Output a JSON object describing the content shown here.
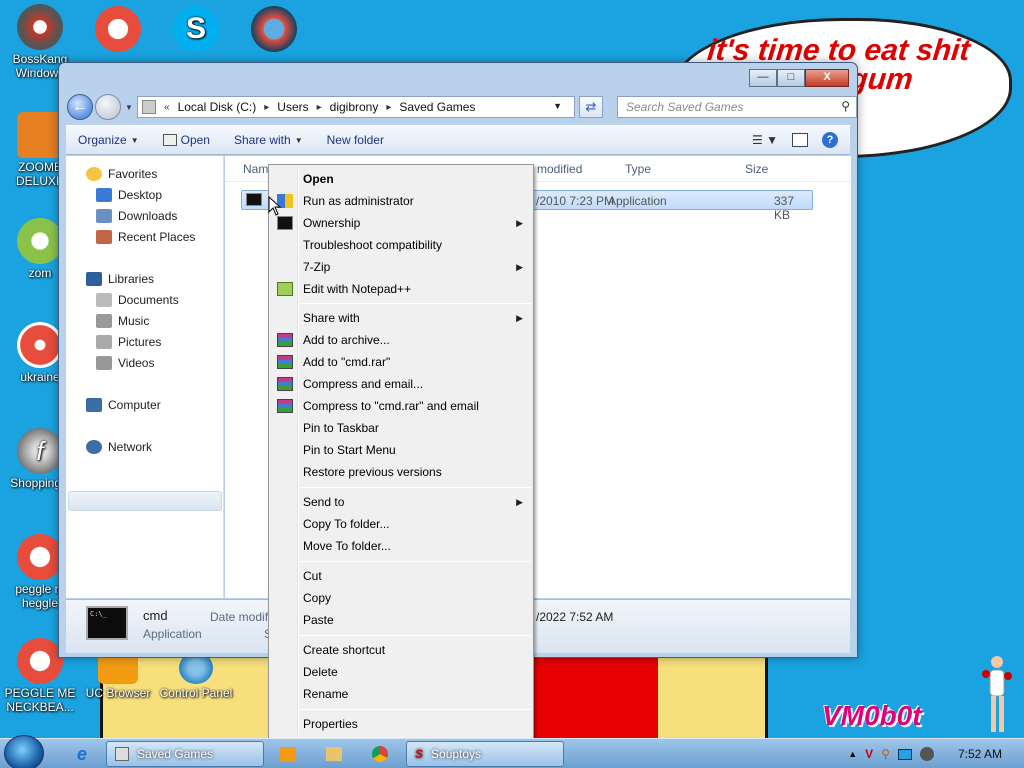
{
  "desktop": {
    "icons": [
      {
        "label": "BossKang Windows",
        "color": "#c0392b"
      },
      {
        "label": "ZOOMB DELUXE",
        "color": "#e67e22"
      },
      {
        "label": "zom",
        "color": "#8bc34a"
      },
      {
        "label": "ukraine",
        "color": "#e74c3c"
      },
      {
        "label": "ShoppingC",
        "color": "#9e9e9e"
      },
      {
        "label": "peggle m heggle",
        "color": "#e74c3c"
      },
      {
        "label": "PEGGLE ME NECKBEA...",
        "color": "#e74c3c"
      },
      {
        "label": "UC Browser",
        "color": "#f39c12"
      },
      {
        "label": "Control Panel",
        "color": "#3498db"
      }
    ],
    "bubble_text": "it's time to eat shit and chew gum",
    "watermark": "VM0b0t"
  },
  "window": {
    "address": [
      "Local Disk (C:)",
      "Users",
      "digibrony",
      "Saved Games"
    ],
    "search_placeholder": "Search Saved Games",
    "caption": {
      "minimize": "—",
      "maximize": "□",
      "close": "X"
    }
  },
  "toolbar": {
    "organize": "Organize",
    "open": "Open",
    "share_with": "Share with",
    "new_folder": "New folder"
  },
  "navpane": {
    "favorites": "Favorites",
    "desktop": "Desktop",
    "downloads": "Downloads",
    "recent_places": "Recent Places",
    "libraries": "Libraries",
    "documents": "Documents",
    "music": "Music",
    "pictures": "Pictures",
    "videos": "Videos",
    "computer": "Computer",
    "network": "Network"
  },
  "columns": {
    "name": "Nam",
    "date_modified": "e modified",
    "type": "Type",
    "size": "Size"
  },
  "file_row": {
    "date": "/2010 7:23 PM",
    "type": "Application",
    "size": "337 KB"
  },
  "details": {
    "name": "cmd",
    "type": "Application",
    "date_label": "Date modifi",
    "date_value": "/2022 7:52 AM",
    "s": "S"
  },
  "context_menu": [
    {
      "label": "Open",
      "bold": true
    },
    {
      "label": "Run as administrator",
      "icon": "shield"
    },
    {
      "label": "Ownership",
      "icon": "cmd",
      "submenu": true
    },
    {
      "label": "Troubleshoot compatibility"
    },
    {
      "label": "7-Zip",
      "submenu": true
    },
    {
      "label": "Edit with Notepad++",
      "icon": "notepad"
    },
    {
      "separator": true
    },
    {
      "label": "Share with",
      "submenu": true
    },
    {
      "label": "Add to archive...",
      "icon": "rar"
    },
    {
      "label": "Add to \"cmd.rar\"",
      "icon": "rar"
    },
    {
      "label": "Compress and email...",
      "icon": "rar"
    },
    {
      "label": "Compress to \"cmd.rar\" and email",
      "icon": "rar"
    },
    {
      "label": "Pin to Taskbar"
    },
    {
      "label": "Pin to Start Menu"
    },
    {
      "label": "Restore previous versions"
    },
    {
      "separator": true
    },
    {
      "label": "Send to",
      "submenu": true
    },
    {
      "label": "Copy To folder..."
    },
    {
      "label": "Move To folder..."
    },
    {
      "separator": true
    },
    {
      "label": "Cut"
    },
    {
      "label": "Copy"
    },
    {
      "label": "Paste"
    },
    {
      "separator": true
    },
    {
      "label": "Create shortcut"
    },
    {
      "label": "Delete"
    },
    {
      "label": "Rename"
    },
    {
      "separator": true
    },
    {
      "label": "Properties"
    }
  ],
  "taskbar": {
    "saved_games": "Saved Games",
    "souptoys": "Souptoys",
    "clock": "7:52 AM"
  },
  "colors": {
    "desktop": "#1aa3e0",
    "bubble_text": "#e00000",
    "menu_bg": "#f0f0f0"
  }
}
